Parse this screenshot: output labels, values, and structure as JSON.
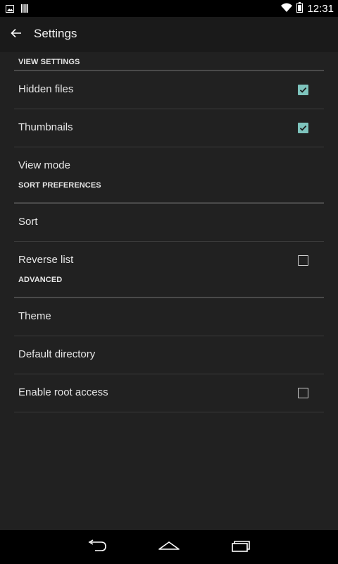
{
  "status_bar": {
    "time": "12:31",
    "icons": [
      "picture-notification-icon",
      "barcode-notification-icon",
      "wifi-icon",
      "battery-icon"
    ]
  },
  "app_bar": {
    "title": "Settings",
    "back_icon": "arrow-back-icon"
  },
  "sections": [
    {
      "header": "VIEW SETTINGS",
      "items": [
        {
          "label": "Hidden files",
          "checkbox": true,
          "checked": true
        },
        {
          "label": "Thumbnails",
          "checkbox": true,
          "checked": true
        },
        {
          "label": "View mode",
          "checkbox": false
        }
      ]
    },
    {
      "header": "SORT PREFERENCES",
      "items": [
        {
          "label": "Sort",
          "checkbox": false
        },
        {
          "label": "Reverse list",
          "checkbox": true,
          "checked": false
        }
      ]
    },
    {
      "header": "ADVANCED",
      "items": [
        {
          "label": "Theme",
          "checkbox": false
        },
        {
          "label": "Default directory",
          "checkbox": false
        },
        {
          "label": "Enable root access",
          "checkbox": true,
          "checked": false
        }
      ]
    }
  ],
  "nav_bar": {
    "buttons": [
      "back-nav-icon",
      "home-nav-icon",
      "recents-nav-icon"
    ]
  },
  "colors": {
    "background": "#212121",
    "app_bar": "#1a1a1a",
    "accent": "#7ec4bd",
    "text": "#e6e6e6"
  }
}
